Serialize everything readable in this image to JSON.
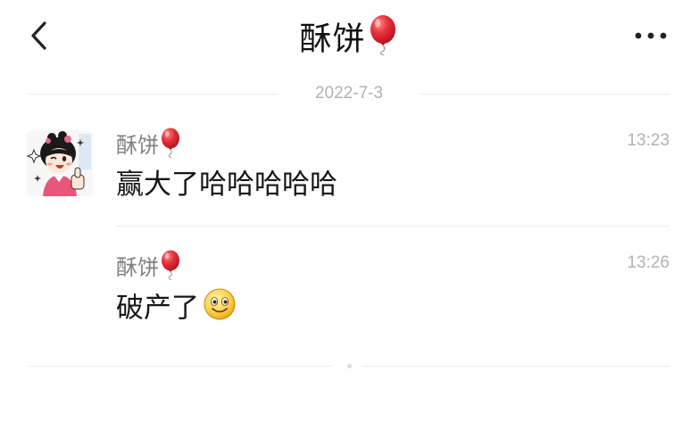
{
  "nav": {
    "title": "酥饼",
    "back_icon": "chevron-left-icon",
    "more_icon": "more-dots-icon",
    "title_icon": "balloon-icon"
  },
  "date_separator": "2022-7-3",
  "messages": [
    {
      "sender": "酥饼",
      "sender_icon": "balloon-icon",
      "time": "13:23",
      "content": "赢大了哈哈哈哈哈"
    },
    {
      "sender": "酥饼",
      "sender_icon": "balloon-icon",
      "time": "13:26",
      "content": "破产了",
      "content_icon": "smile-emoji-icon"
    }
  ],
  "colors": {
    "background": "#ffffff",
    "balloon": "#e8323c",
    "muted_text": "#b2b2b2",
    "sender_text": "#808080",
    "divider": "#ececec"
  }
}
